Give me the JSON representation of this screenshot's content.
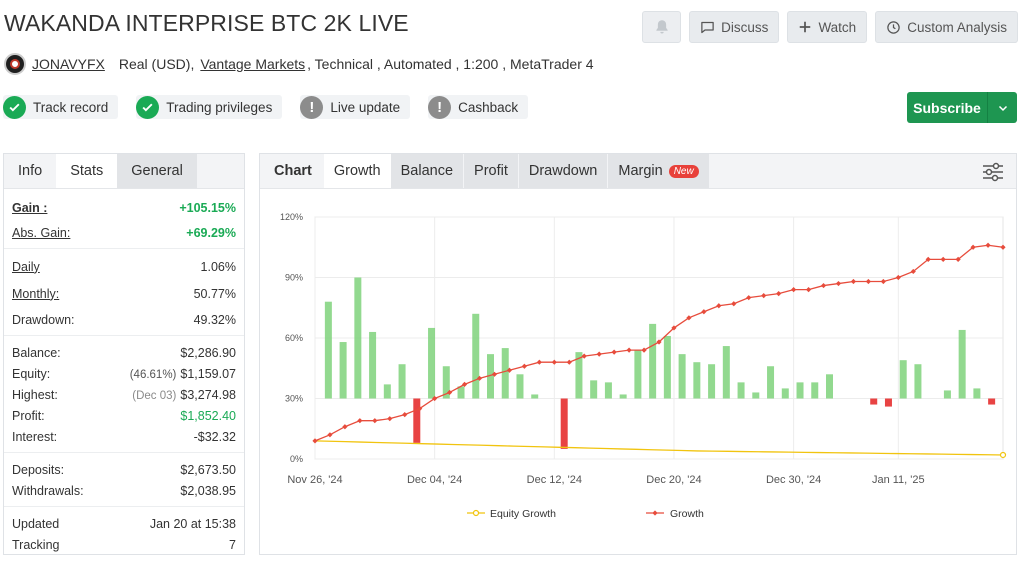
{
  "header": {
    "title": "WAKANDA INTERPRISE BTC 2K LIVE",
    "buttons": {
      "discuss": "Discuss",
      "watch": "Watch",
      "custom_analysis": "Custom Analysis"
    },
    "icons": {
      "bell": "bell-icon",
      "discuss": "chat-bubble-icon",
      "watch": "plus-icon",
      "custom": "clock-icon"
    }
  },
  "account": {
    "user": "JONAVYFX",
    "type": "Real (USD),",
    "broker": "Vantage Markets",
    "details": ", Technical , Automated , 1:200 , MetaTrader 4"
  },
  "badges": [
    {
      "label": "Track record",
      "status": "ok"
    },
    {
      "label": "Trading privileges",
      "status": "ok"
    },
    {
      "label": "Live update",
      "status": "warn"
    },
    {
      "label": "Cashback",
      "status": "warn"
    }
  ],
  "subscribe": {
    "label": "Subscribe",
    "color": "#1e9651"
  },
  "left_tabs": [
    "Info",
    "Stats",
    "General"
  ],
  "stats": {
    "gain": {
      "label": "Gain :",
      "value": "+105.15%"
    },
    "abs_gain": {
      "label": "Abs. Gain:",
      "value": "+69.29%"
    },
    "daily": {
      "label": "Daily",
      "value": "1.06%"
    },
    "monthly": {
      "label": "Monthly:",
      "value": "50.77%"
    },
    "drawdown": {
      "label": "Drawdown:",
      "value": "49.32%"
    },
    "balance": {
      "label": "Balance:",
      "value": "$2,286.90"
    },
    "equity": {
      "label": "Equity:",
      "note": "(46.61%)",
      "value": "$1,159.07"
    },
    "highest": {
      "label": "Highest:",
      "note": "(Dec 03)",
      "value": "$3,274.98"
    },
    "profit": {
      "label": "Profit:",
      "value": "$1,852.40"
    },
    "interest": {
      "label": "Interest:",
      "value": "-$32.32"
    },
    "deposits": {
      "label": "Deposits:",
      "value": "$2,673.50"
    },
    "withdrawals": {
      "label": "Withdrawals:",
      "value": "$2,038.95"
    },
    "updated": {
      "label": "Updated",
      "value": "Jan 20 at 15:38"
    },
    "tracking": {
      "label": "Tracking",
      "value": "7"
    }
  },
  "chart_tabs": {
    "chart": "Chart",
    "growth": "Growth",
    "balance": "Balance",
    "profit": "Profit",
    "drawdown": "Drawdown",
    "margin": "Margin",
    "new_badge": "New"
  },
  "chart_data": {
    "type": "line",
    "ylim": [
      0,
      120
    ],
    "y_ticks": [
      "0%",
      "30%",
      "60%",
      "90%",
      "120%"
    ],
    "y_tick_values": [
      0,
      30,
      60,
      90,
      120
    ],
    "x_tick_labels": [
      "Nov 26, '24",
      "Dec 04, '24",
      "Dec 12, '24",
      "Dec 20, '24",
      "Dec 30, '24",
      "Jan 11, '25"
    ],
    "x_tick_index": [
      0,
      8,
      16,
      24,
      32,
      39
    ],
    "bar_baseline": 30,
    "daily_bars": [
      48,
      28,
      60,
      33,
      7,
      17,
      -22,
      35,
      16,
      6,
      42,
      22,
      25,
      12,
      2,
      0,
      -25,
      23,
      9,
      8,
      2,
      24,
      37,
      31,
      22,
      18,
      17,
      26,
      8,
      3,
      16,
      5,
      8,
      8,
      12,
      0,
      0,
      -3,
      -4,
      19,
      17,
      0,
      4,
      34,
      5,
      -3
    ],
    "series": [
      {
        "name": "Equity Growth",
        "color": "#f1c40f",
        "values": [
          9,
          8.8,
          8.6,
          8.4,
          8.2,
          8,
          7.8,
          7.6,
          7.4,
          7.2,
          7,
          6.8,
          6.6,
          6.4,
          6.2,
          6,
          5.8,
          5.6,
          5.4,
          5.2,
          5,
          4.8,
          4.6,
          4.4,
          4.2,
          4,
          3.9,
          3.8,
          3.7,
          3.6,
          3.5,
          3.4,
          3.3,
          3.2,
          3.1,
          3.0,
          2.9,
          2.8,
          2.7,
          2.6,
          2.5,
          2.4,
          2.3,
          2.2,
          2.1,
          2.0
        ]
      },
      {
        "name": "Growth",
        "color": "#e74c3c",
        "values": [
          9,
          12,
          16,
          19,
          19,
          20,
          22,
          25,
          30,
          33,
          37,
          40,
          42,
          44,
          46,
          48,
          48,
          48,
          51,
          52,
          53,
          54,
          54,
          58,
          65,
          70,
          73,
          76,
          77,
          80,
          81,
          82,
          84,
          84,
          86,
          87,
          88,
          88,
          88,
          90,
          93,
          99,
          99,
          99,
          105,
          106,
          105
        ]
      }
    ]
  }
}
